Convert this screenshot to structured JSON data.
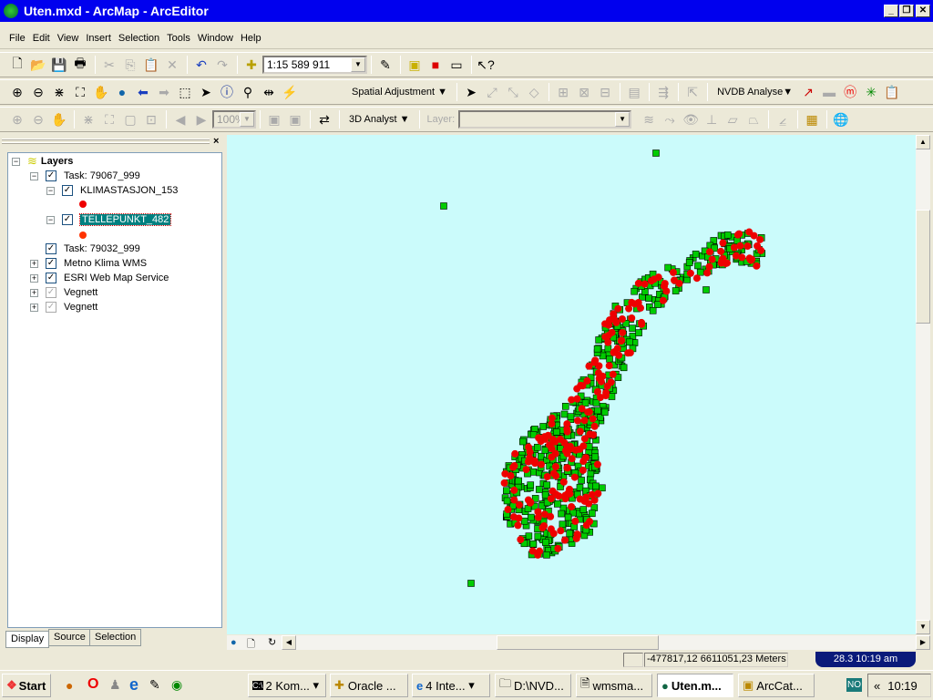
{
  "window": {
    "title": "Uten.mxd - ArcMap - ArcEditor",
    "min": "_",
    "max": "❐",
    "close": "✕"
  },
  "menu": [
    "File",
    "Edit",
    "View",
    "Insert",
    "Selection",
    "Tools",
    "Window",
    "Help"
  ],
  "toolbar": {
    "scale": "1:15 589 911",
    "spatial_adjustment": "Spatial Adjustment",
    "nvdb": "NVDB Analyse",
    "analyst3d": "3D Analyst",
    "layer_label": "Layer:",
    "zoom_pct": "100%"
  },
  "toc": {
    "root": "Layers",
    "items": [
      {
        "label": "Task: 79067_999"
      },
      {
        "label": "KLIMASTASJON_153"
      },
      {
        "label": "TELLEPUNKT_482"
      },
      {
        "label": "Task: 79032_999"
      },
      {
        "label": "Metno Klima WMS"
      },
      {
        "label": "ESRI Web Map Service"
      },
      {
        "label": "Vegnett"
      },
      {
        "label": "Vegnett"
      }
    ],
    "tabs": [
      "Display",
      "Source",
      "Selection"
    ]
  },
  "colors": {
    "klimastasjon": "#ee0000",
    "tellepunkt": "#00cc00",
    "map_bg": "#cbfbfb",
    "title": "#0000ee"
  },
  "status": {
    "coords": "-477817,12  6611051,23 Meters",
    "clock_pill": "28.3  10:19 am"
  },
  "taskbar": {
    "start": "Start",
    "tasks": [
      "2 Kom...",
      "Oracle ...",
      "4 Inte...",
      "D:\\NVD...",
      "wmsma...",
      "Uten.m...",
      "ArcCat..."
    ],
    "lang": "NO",
    "chev": "«",
    "time": "10:19"
  }
}
